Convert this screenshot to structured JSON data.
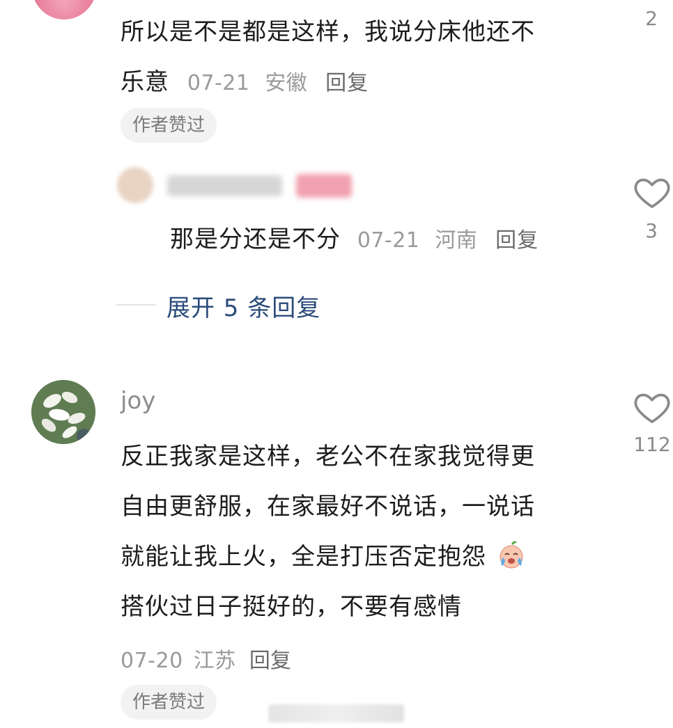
{
  "comment1": {
    "text_line1": "所以是不是都是这样，我说分床他还不",
    "text_line2": "乐意",
    "date": "07-21",
    "location": "安徽",
    "reply_label": "回复",
    "badge": "作者赞过",
    "like_count": "2"
  },
  "reply1": {
    "text": "那是分还是不分",
    "date": "07-21",
    "location": "河南",
    "reply_label": "回复",
    "like_count": "3"
  },
  "expand": {
    "label": "展开 5 条回复"
  },
  "comment2": {
    "username": "joy",
    "lines": [
      "反正我家是这样，老公不在家我觉得更",
      "自由更舒服，在家最好不说话，一说话",
      "就能让我上火，全是打压否定抱怨",
      "搭伙过日子挺好的，不要有感情"
    ],
    "date": "07-20",
    "location": "江苏",
    "reply_label": "回复",
    "badge": "作者赞过",
    "like_count": "112"
  }
}
